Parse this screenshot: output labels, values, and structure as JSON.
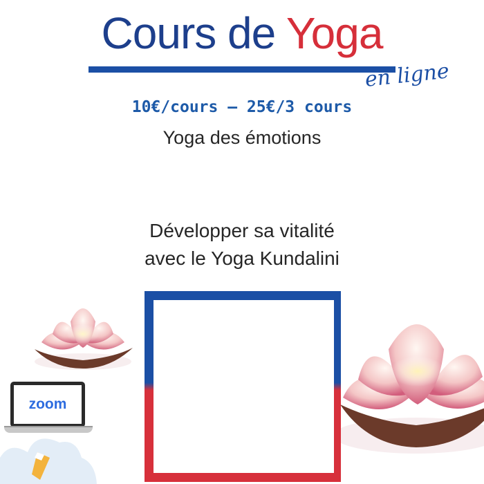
{
  "header": {
    "title_main": "Cours de",
    "title_accent": "Yoga",
    "subtitle_script": "en ligne"
  },
  "price": "10€/cours – 25€/3 cours",
  "theme": "Yoga des émotions",
  "description": {
    "line1": "Développer sa vitalité",
    "line2": "avec le Yoga Kundalini"
  },
  "laptop": {
    "screen_label": "zoom"
  },
  "colors": {
    "title_blue": "#1d3f8c",
    "title_red": "#d62f3a",
    "frame_blue": "#1b4fa5",
    "frame_red": "#d7303b",
    "price_blue": "#1d5aa8",
    "zoom_blue": "#2d6cdf"
  },
  "icons": [
    "lotus-flower-icon",
    "laptop-icon",
    "cloud-icon"
  ]
}
